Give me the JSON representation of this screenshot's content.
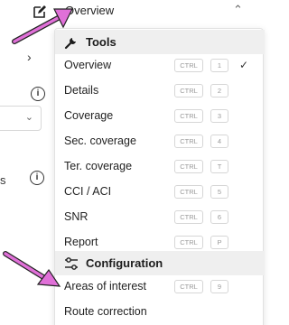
{
  "header": {
    "current_view": "Overview"
  },
  "background": {
    "partial_label": "s"
  },
  "menu": {
    "tools_heading": "Tools",
    "tools": [
      {
        "label": "Overview",
        "ctrl": "CTRL",
        "key": "1",
        "selected": true
      },
      {
        "label": "Details",
        "ctrl": "CTRL",
        "key": "2"
      },
      {
        "label": "Coverage",
        "ctrl": "CTRL",
        "key": "3"
      },
      {
        "label": "Sec. coverage",
        "ctrl": "CTRL",
        "key": "4"
      },
      {
        "label": "Ter. coverage",
        "ctrl": "CTRL",
        "key": "T"
      },
      {
        "label": "CCI / ACI",
        "ctrl": "CTRL",
        "key": "5"
      },
      {
        "label": "SNR",
        "ctrl": "CTRL",
        "key": "6"
      },
      {
        "label": "Report",
        "ctrl": "CTRL",
        "key": "P"
      }
    ],
    "configuration_heading": "Configuration",
    "configuration": [
      {
        "label": "Areas of interest",
        "ctrl": "CTRL",
        "key": "9"
      },
      {
        "label": "Route correction"
      }
    ]
  },
  "colors": {
    "annotation_arrow": "#e070d8",
    "section_bg": "#efefef"
  }
}
